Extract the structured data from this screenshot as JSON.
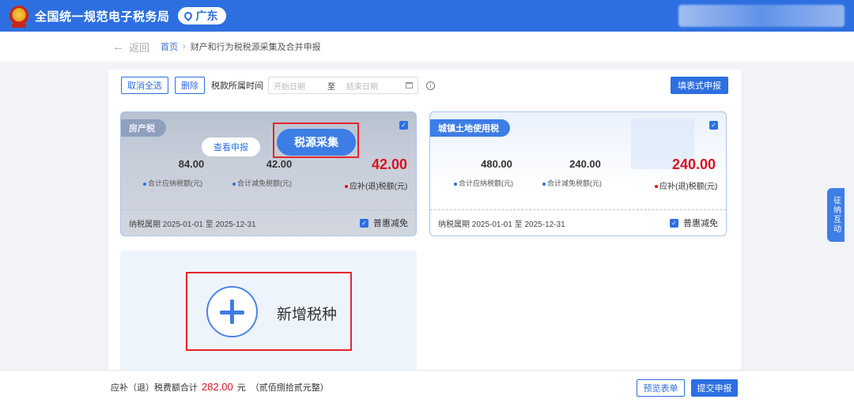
{
  "header": {
    "site_title": "全国统一规范电子税务局",
    "region": "广东"
  },
  "nav": {
    "back_label": "返回",
    "breadcrumb_home": "首页",
    "breadcrumb_sep": "›",
    "breadcrumb_current": "财产和行为税税源采集及合并申报"
  },
  "toolbar": {
    "deselect_all": "取消全选",
    "delete": "删除",
    "period_label": "税款所属时间",
    "start_placeholder": "开始日期",
    "to_label": "至",
    "end_placeholder": "结束日期",
    "info": "i",
    "form_declare": "填表式申报"
  },
  "cards": [
    {
      "tax_name": "房产税",
      "checked": true,
      "total_payable": "84.00",
      "total_payable_label": "合计应纳税额(元)",
      "total_relief": "42.00",
      "total_relief_label": "合计减免税额(元)",
      "due": "42.00",
      "due_label": "应补(退)税额(元)",
      "period": "纳税属期 2025-01-01 至 2025-12-31",
      "preferential": "普惠减免",
      "view_button": "查看申报",
      "collect_button": "税源采集"
    },
    {
      "tax_name": "城镇土地使用税",
      "checked": true,
      "total_payable": "480.00",
      "total_payable_label": "合计应纳税额(元)",
      "total_relief": "240.00",
      "total_relief_label": "合计减免税额(元)",
      "due": "240.00",
      "due_label": "应补(退)税额(元)",
      "period": "纳税属期 2025-01-01 至 2025-12-31",
      "preferential": "普惠减免"
    }
  ],
  "add_tax": {
    "label": "新增税种"
  },
  "side_tab": {
    "label": "征纳互动"
  },
  "footer": {
    "total_label": "应补（退）税费额合计",
    "total_amount": "282.00",
    "unit": "元",
    "amount_in_words": "（贰佰捌拾贰元整）",
    "preview_button": "预览表单",
    "submit_button": "提交申报"
  },
  "colors": {
    "primary": "#2d6fe0",
    "highlight_red": "#e2262c",
    "amount_red": "#d9141e"
  },
  "icons": {
    "check": "✓",
    "back": "←"
  }
}
